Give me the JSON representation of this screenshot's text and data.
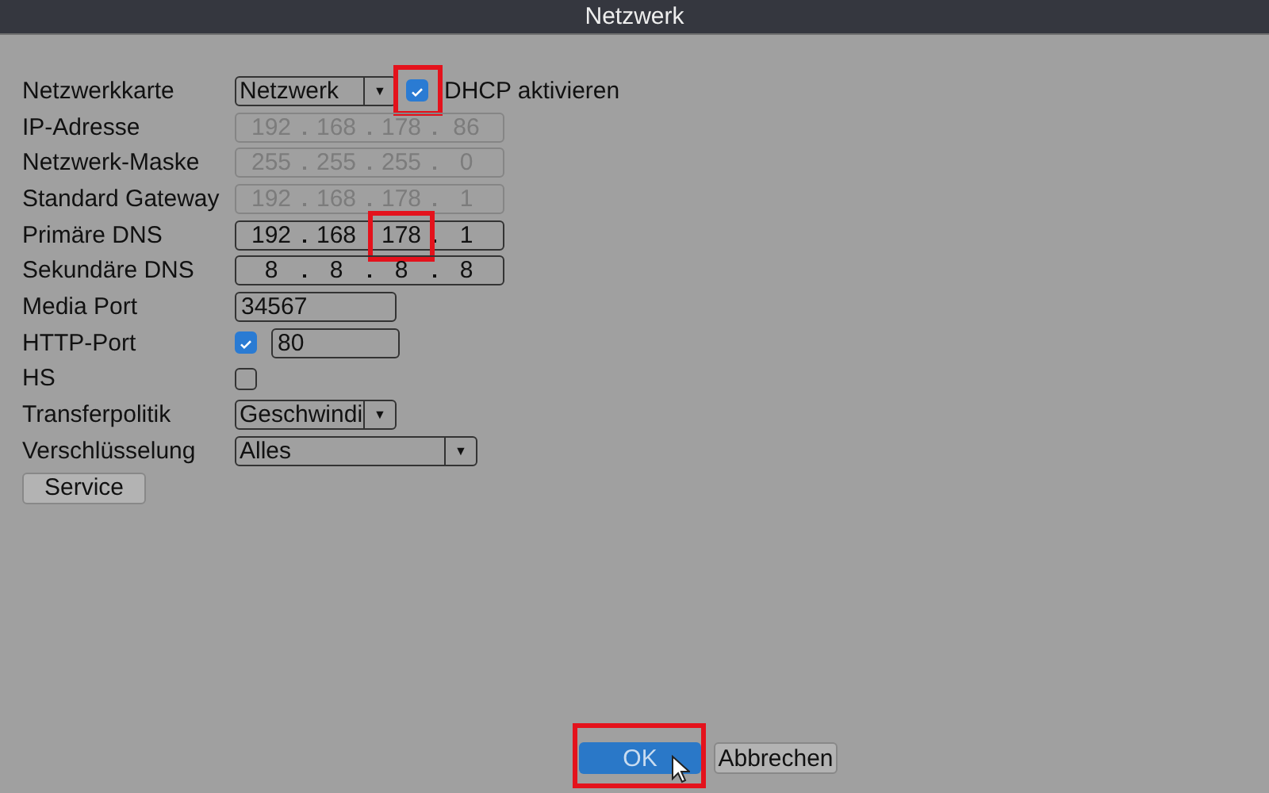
{
  "window": {
    "title": "Netzwerk"
  },
  "rows": [
    {
      "kind": "dropdown",
      "label": "Netzwerkkarte",
      "value": "Netzwerk",
      "arrow": "▼",
      "checkbox": {
        "label": "DHCP aktivieren",
        "checked": true,
        "highlighted": true
      }
    },
    {
      "kind": "ip",
      "label": "IP-Adresse",
      "disabled": true,
      "octets": [
        {
          "value": "192",
          "highlighted": false
        },
        {
          "value": "168",
          "highlighted": false
        },
        {
          "value": "178",
          "highlighted": false
        },
        {
          "value": "86",
          "highlighted": false
        }
      ]
    },
    {
      "kind": "ip",
      "label": "Netzwerk-Maske",
      "disabled": true,
      "octets": [
        {
          "value": "255",
          "highlighted": false
        },
        {
          "value": "255",
          "highlighted": false
        },
        {
          "value": "255",
          "highlighted": false
        },
        {
          "value": "0",
          "highlighted": false
        }
      ]
    },
    {
      "kind": "ip",
      "label": "Standard Gateway",
      "disabled": true,
      "octets": [
        {
          "value": "192",
          "highlighted": false
        },
        {
          "value": "168",
          "highlighted": false
        },
        {
          "value": "178",
          "highlighted": false
        },
        {
          "value": "1",
          "highlighted": false
        }
      ]
    },
    {
      "kind": "ip",
      "label": "Primäre DNS",
      "disabled": false,
      "octets": [
        {
          "value": "192",
          "highlighted": false
        },
        {
          "value": "168",
          "highlighted": false
        },
        {
          "value": "178",
          "highlighted": true
        },
        {
          "value": "1",
          "highlighted": false
        }
      ]
    },
    {
      "kind": "ip",
      "label": "Sekundäre DNS",
      "disabled": false,
      "octets": [
        {
          "value": "8",
          "highlighted": false
        },
        {
          "value": "8",
          "highlighted": false
        },
        {
          "value": "8",
          "highlighted": false
        },
        {
          "value": "8",
          "highlighted": false
        }
      ]
    },
    {
      "kind": "text",
      "label": "Media Port",
      "value": "34567"
    },
    {
      "kind": "check-text",
      "label": "HTTP-Port",
      "checked": true,
      "value": "80"
    },
    {
      "kind": "check",
      "label": "HS",
      "checked": false
    },
    {
      "kind": "dropdown",
      "label": "Transferpolitik",
      "value": "Geschwindi",
      "arrow": "▼"
    },
    {
      "kind": "wide-dropdown",
      "label": "Verschlüsselung",
      "value": "Alles",
      "arrow": "▼"
    }
  ],
  "service_button": "Service",
  "buttons": [
    {
      "label": "OK",
      "focused": true,
      "highlighted": true
    },
    {
      "label": "Abbrechen",
      "focused": false,
      "highlighted": false
    }
  ]
}
